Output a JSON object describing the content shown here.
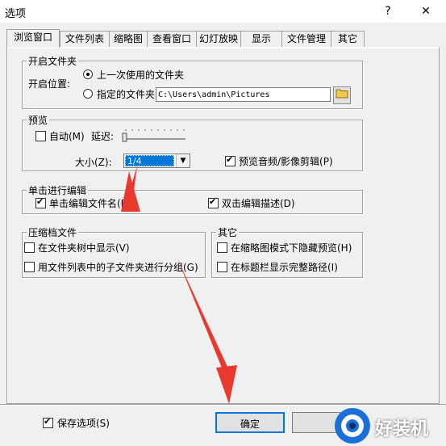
{
  "window": {
    "title": "选项",
    "help": "?",
    "close": "✕"
  },
  "tabs": [
    "浏览窗口",
    "文件列表",
    "缩略图",
    "查看窗口",
    "幻灯放映",
    "显示",
    "文件管理",
    "其它"
  ],
  "startup": {
    "group_title": "开启文件夹",
    "position_label": "开启位置:",
    "option_last": "上一次使用的文件夹",
    "option_specified": "指定的文件夹:",
    "path_value": "C:\\Users\\admin\\Pictures"
  },
  "preview": {
    "group_title": "预览",
    "auto_label": "自动(M)",
    "delay_label": "延迟:",
    "size_label": "大小(Z):",
    "size_value": "1/4",
    "media_label": "预览音频/影像剪辑(P)"
  },
  "single_click": {
    "group_title": "单击进行编辑",
    "edit_filename": "单击编辑文件名(E)",
    "edit_desc": "双击编辑描述(D)"
  },
  "archive": {
    "group_title": "压缩档文件",
    "show_in_tree": "在文件夹树中显示(V)",
    "group_subfolders": "用文件列表中的子文件夹进行分组(G)"
  },
  "other": {
    "group_title": "其它",
    "hide_preview": "在缩略图模式下隐藏预览(H)",
    "full_path": "在标题栏显示完整路径(I)"
  },
  "footer": {
    "save_options": "保存选项(S)",
    "ok": "确定"
  },
  "watermark": "好装机",
  "colors": {
    "accent": "#0078d7",
    "arrow": "#e8392e"
  }
}
